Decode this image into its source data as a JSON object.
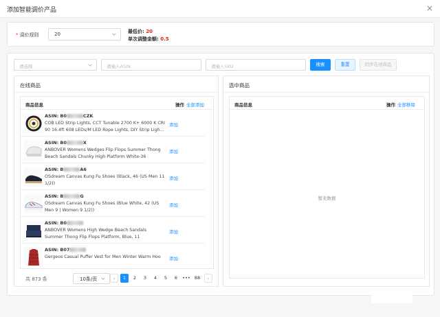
{
  "dialog": {
    "title": "添加智能调价产品",
    "close_icon": "×"
  },
  "rule": {
    "label": "调价规则",
    "required_mark": "*",
    "value": "20",
    "min_price_label": "最低价:",
    "min_price_value": "20",
    "step_label": "单次调整金额:",
    "step_value": "0.5"
  },
  "filters": {
    "select_placeholder": "请选择",
    "asin_placeholder": "请输入ASIN",
    "sku_placeholder": "请输入SKU",
    "search_label": "搜索",
    "reset_label": "重置",
    "sync_label": "同步在线商品"
  },
  "online": {
    "title": "在线商品",
    "col_info": "商品信息",
    "col_action": "操作",
    "add_all": "全部添加",
    "rows": [
      {
        "asin_prefix": "ASIN:  B0",
        "asin_suffix": "CZK",
        "title": "COB LED Strip Lights, CCT Tunable 2700 K+ 6000 K CRI 90 16.4ft 608 LEDs/M LED Rope Lights, DIY Strip Ligh...",
        "action": "添加",
        "thumb": "led-strip"
      },
      {
        "asin_prefix": "ASIN:  B0",
        "asin_suffix": "X",
        "title": "ANBOVER Womens Wedges Flip Flops Summer Thong Beach Sandals Chunky High Platform White-36",
        "action": "添加",
        "thumb": "white-sandal"
      },
      {
        "asin_prefix": "ASIN:  B",
        "asin_suffix": "A6",
        "title": "OSdream Canvas Kung Fu Shoes (Black, 46 (US Men 11 1/2))",
        "action": "添加",
        "thumb": "black-shoe"
      },
      {
        "asin_prefix": "ASIN:  B",
        "asin_suffix": "G",
        "title": "OSdream Canvas Kung Fu Shoes (Blue White, 42 (US Men 9 | Women 9 1/2))",
        "action": "添加",
        "thumb": "blue-shoe"
      },
      {
        "asin_prefix": "ASIN:  B0",
        "asin_suffix": "",
        "title": "ANBOVER Womens High Wedge Beach Sandals Summer Thong Flip Flops Platform, Blue, 11",
        "action": "添加",
        "thumb": "navy-sandal"
      },
      {
        "asin_prefix": "ASIN:  B07",
        "asin_suffix": "",
        "title": "Gergeos Casual Puffer Vest for Men Winter Warm Hoo",
        "action": "添加",
        "thumb": "red-vest"
      }
    ],
    "pagination": {
      "total": "共 873 条",
      "page_size": "10条/页",
      "pages": [
        "1",
        "2",
        "3",
        "4",
        "5",
        "6",
        "•••",
        "88"
      ],
      "current": "1",
      "prev": "‹",
      "next": "›"
    }
  },
  "selected": {
    "title": "选中商品",
    "col_info": "商品信息",
    "col_action": "操作",
    "remove_all": "全部移除",
    "empty_text": "暂无数据"
  },
  "colors": {
    "primary": "#1890ff",
    "danger": "#e02020"
  }
}
